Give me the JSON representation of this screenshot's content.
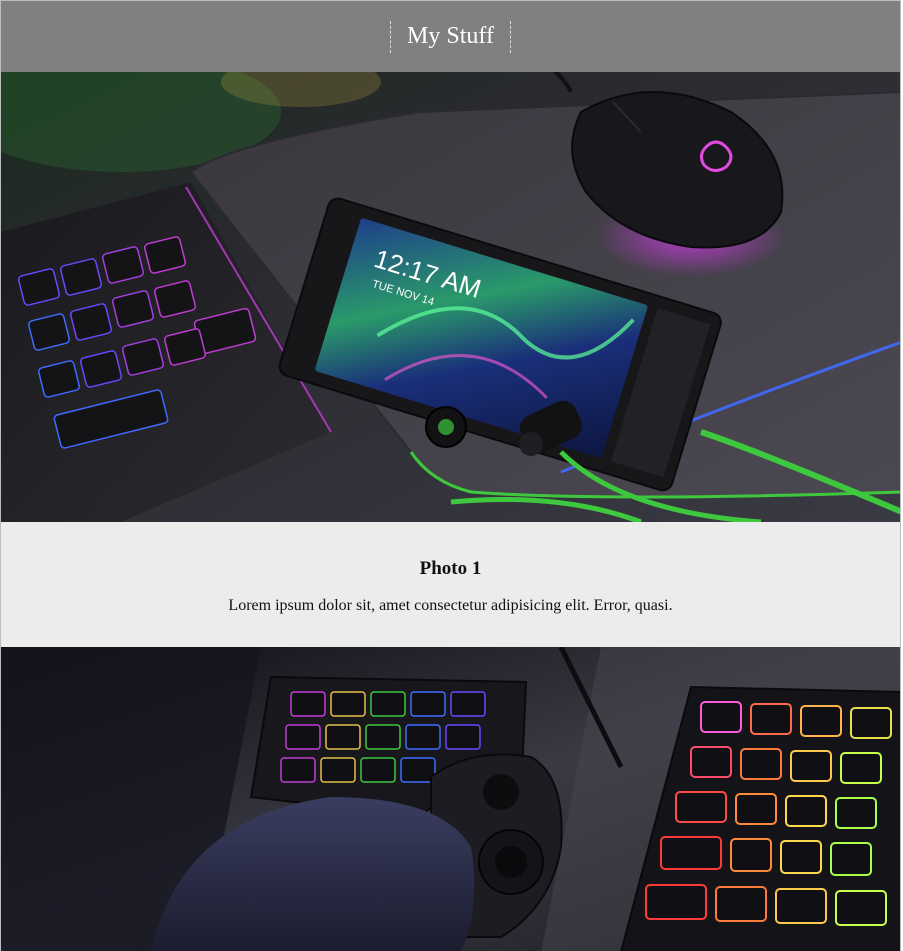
{
  "header": {
    "title": "My Stuff"
  },
  "items": [
    {
      "image": "gaming-phone-desk-photo",
      "title": "Photo 1",
      "text": "Lorem ipsum dolor sit, amet consectetur adipisicing elit. Error, quasi.",
      "phone_time": "12:17 AM",
      "phone_date": "TUE NOV 14"
    },
    {
      "image": "gaming-keypad-keyboard-photo"
    }
  ],
  "colors": {
    "header_bg": "#808080",
    "caption_bg": "#ececec",
    "neon_green": "#3ec83e",
    "neon_magenta": "#c23cd6",
    "neon_blue": "#3f6bff"
  }
}
